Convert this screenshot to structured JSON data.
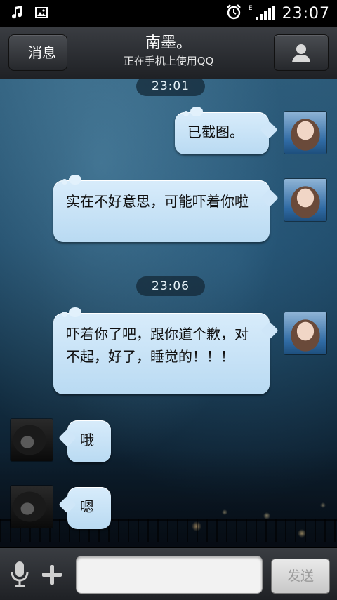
{
  "status_bar": {
    "time": "23:07",
    "network_type": "E",
    "icons": [
      "music-icon",
      "image-icon",
      "alarm-icon",
      "signal-icon"
    ]
  },
  "header": {
    "back_label": "消息",
    "title": "南墨。",
    "subtitle": "正在手机上使用QQ",
    "profile_icon": "person-icon"
  },
  "messages": [
    {
      "type": "timestamp",
      "text": "23:01"
    },
    {
      "type": "message",
      "from": "me",
      "text": "已截图。"
    },
    {
      "type": "message",
      "from": "me",
      "text": "实在不好意思，可能吓着你啦"
    },
    {
      "type": "timestamp",
      "text": "23:06"
    },
    {
      "type": "message",
      "from": "me",
      "text": "吓着你了吧，跟你道个歉，对不起，好了，睡觉的！！！"
    },
    {
      "type": "message",
      "from": "other",
      "text": "哦"
    },
    {
      "type": "message",
      "from": "other",
      "text": "嗯"
    }
  ],
  "input_bar": {
    "input_value": "",
    "input_placeholder": "",
    "send_label": "发送",
    "icons": [
      "microphone-icon",
      "plus-icon"
    ]
  },
  "colors": {
    "bubble": "#c9e3f7",
    "header": "#2a2c30",
    "timestamp_bg": "#1c3a4e"
  }
}
